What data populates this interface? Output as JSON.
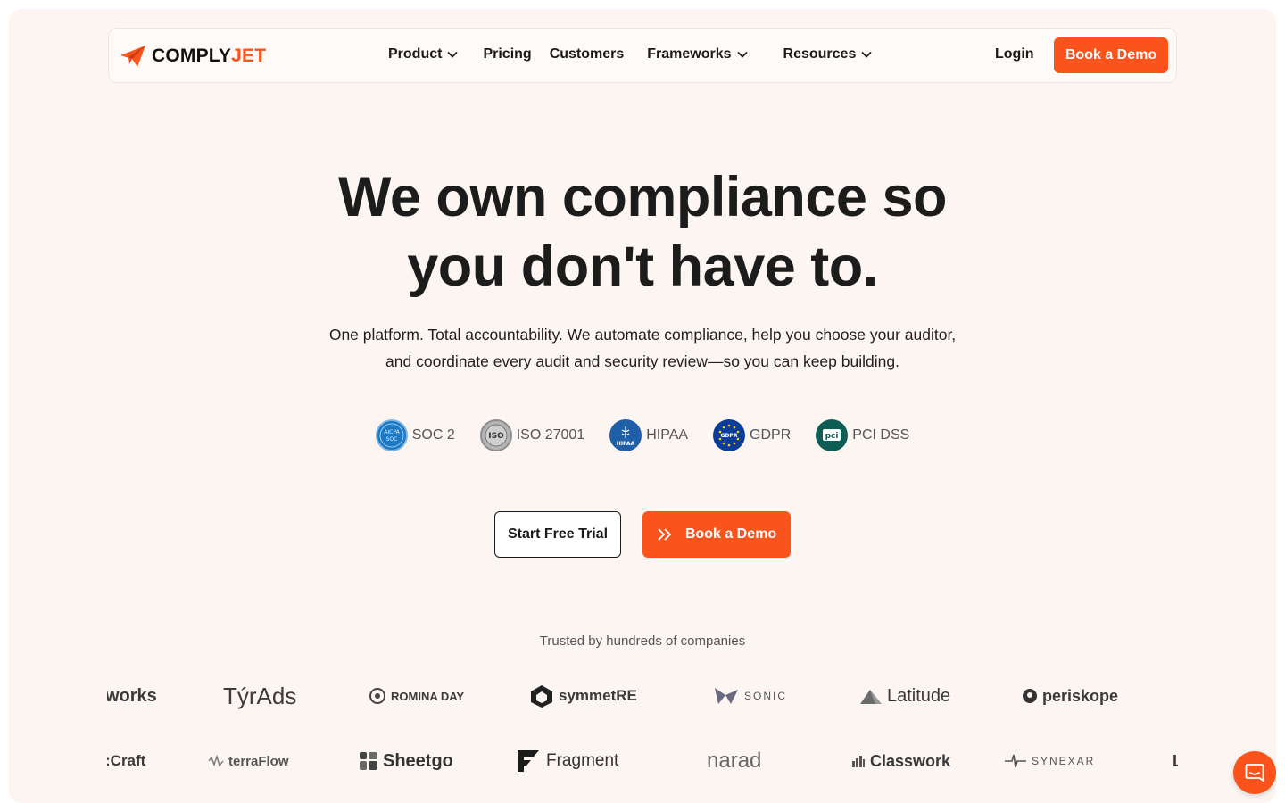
{
  "brand": {
    "name_part1": "COMPLY",
    "name_part2": "JET",
    "accent": "#fa541c"
  },
  "nav": {
    "items": [
      {
        "label": "Product",
        "dropdown": true
      },
      {
        "label": "Pricing",
        "dropdown": false
      },
      {
        "label": "Customers",
        "dropdown": false
      },
      {
        "label": "Frameworks",
        "dropdown": true
      },
      {
        "label": "Resources",
        "dropdown": true
      }
    ],
    "login": "Login",
    "cta": "Book a Demo"
  },
  "hero": {
    "title_line1": "We own compliance so",
    "title_line2": "you don't have to.",
    "subtitle_line1": "One platform. Total accountability. We automate compliance, help you choose your auditor,",
    "subtitle_line2": "and coordinate every audit and security review—so you can keep building."
  },
  "badges": [
    {
      "label": "SOC 2",
      "icon": "aicpa-soc-icon",
      "color": "#1b78c2"
    },
    {
      "label": "ISO 27001",
      "icon": "iso-icon",
      "color": "#9c9c9c"
    },
    {
      "label": "HIPAA",
      "icon": "hipaa-icon",
      "color": "#1f5fa8"
    },
    {
      "label": "GDPR",
      "icon": "gdpr-icon",
      "color": "#0b3c9a"
    },
    {
      "label": "PCI DSS",
      "icon": "pci-icon",
      "color": "#0d5d55"
    }
  ],
  "cta": {
    "primary_outline": "Start Free Trial",
    "primary_solid": "Book a Demo"
  },
  "trusted": {
    "label": "Trusted by hundreds of companies",
    "row1": [
      "works",
      "TýrAds",
      "ROMINA DAY",
      "symmetRE",
      "SONIC",
      "Latitude",
      "periskope"
    ],
    "row2": [
      ":Craft",
      "terraFlow",
      "Sheetgo",
      "Fragment",
      "narad",
      "Classwork",
      "SYNEXAR",
      "L"
    ]
  },
  "chat": {
    "icon": "chat-icon"
  }
}
